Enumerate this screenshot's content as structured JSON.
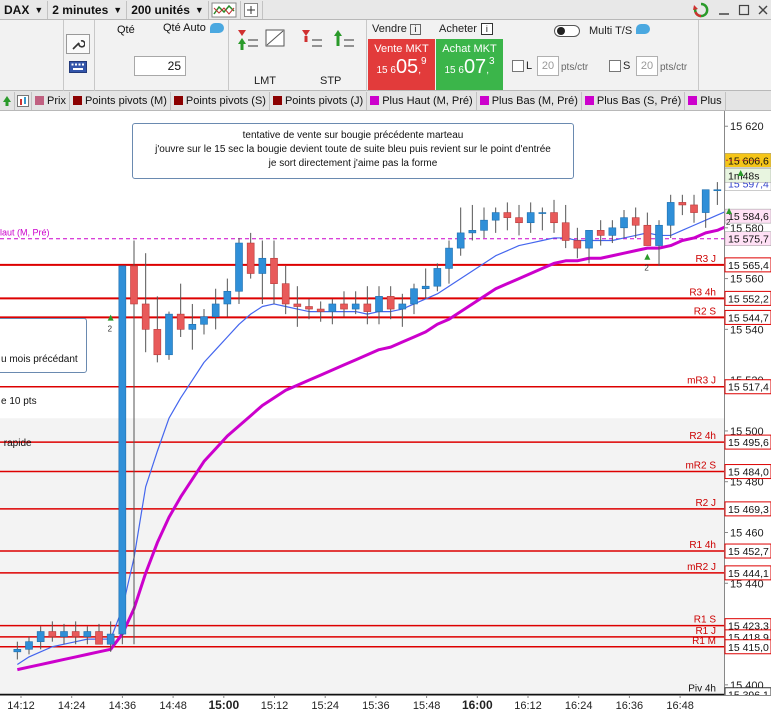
{
  "toolbar": {
    "instrument": "DAX",
    "interval": "2 minutes",
    "units": "200 unités"
  },
  "order_panel": {
    "qty_label": "Qté",
    "qty_auto_label": "Qté Auto",
    "qty_value": "25",
    "lmt_label": "LMT",
    "stp_label": "STP",
    "sell_label": "Vendre",
    "buy_label": "Acheter",
    "sell_mkt": {
      "label": "Vente MKT",
      "prefix": "15 6",
      "big": "05",
      "sup": "9"
    },
    "buy_mkt": {
      "label": "Achat MKT",
      "prefix": "15 6",
      "big": "07",
      "sup": "3"
    },
    "multi_ts_label": "Multi T/S",
    "l_label": "L",
    "s_label": "S",
    "pts_value": "20",
    "pts_unit": "pts/ctr",
    "colors": {
      "sell": "#e23b3b",
      "buy": "#3bb54a"
    }
  },
  "indicators": [
    {
      "label": "Prix",
      "color": "#c06080"
    },
    {
      "label": "Points pivots (M)",
      "color": "#8b0000"
    },
    {
      "label": "Points pivots (S)",
      "color": "#8b0000"
    },
    {
      "label": "Points pivots (J)",
      "color": "#8b0000"
    },
    {
      "label": "Plus Haut (M, Pré)",
      "color": "#cc00cc"
    },
    {
      "label": "Plus Bas (M, Pré)",
      "color": "#cc00cc"
    },
    {
      "label": "Plus Bas (S, Pré)",
      "color": "#cc00cc"
    },
    {
      "label": "Plus",
      "color": "#cc00cc"
    }
  ],
  "annotations": {
    "main_lines": [
      "tentative de vente sur bougie précédente marteau",
      "j'ouvre sur le 15 sec la bougie devient toute de suite bleu puis revient sur le point d'entrée",
      "je sort directement j'aime pas la forme"
    ],
    "left_lines": [
      "u mois précédant",
      "e 10 pts",
      " rapide"
    ]
  },
  "chart_data": {
    "type": "candlestick",
    "ylim": [
      15396,
      15626
    ],
    "y_ticks": [
      15400,
      15420,
      15440,
      15460,
      15480,
      15500,
      15520,
      15540,
      15560,
      15580,
      15600,
      15620
    ],
    "x_ticks": [
      "14:12",
      "14:24",
      "14:36",
      "14:48",
      "15:00",
      "15:12",
      "15:24",
      "15:36",
      "15:48",
      "16:00",
      "16:12",
      "16:24",
      "16:36",
      "16:48"
    ],
    "bold_x_ticks": [
      "15:00",
      "16:00"
    ],
    "current_price": "15 606,6",
    "timer": "1m48s",
    "levels": [
      {
        "label": "R3 J",
        "value": 15565.4,
        "price": "15 565,4",
        "color": "#dd0000",
        "width": 2
      },
      {
        "label": "R3 4h",
        "value": 15552.2,
        "price": "15 552,2",
        "color": "#dd0000",
        "width": 2
      },
      {
        "label": "R2 S",
        "value": 15544.7,
        "price": "15 544,7",
        "color": "#dd0000",
        "width": 2
      },
      {
        "label": "mR3 J",
        "value": 15517.4,
        "price": "15 517,4",
        "color": "#dd0000",
        "width": 1.5
      },
      {
        "label": "R2 4h",
        "value": 15495.6,
        "price": "15 495,6",
        "color": "#dd0000",
        "width": 1.5
      },
      {
        "label": "mR2 S",
        "value": 15484.0,
        "price": "15 484,0",
        "color": "#dd0000",
        "width": 1.5
      },
      {
        "label": "R2 J",
        "value": 15469.3,
        "price": "15 469,3",
        "color": "#dd0000",
        "width": 1.5
      },
      {
        "label": "R1 4h",
        "value": 15452.7,
        "price": "15 452,7",
        "color": "#dd0000",
        "width": 1.5
      },
      {
        "label": "mR2 J",
        "value": 15444.1,
        "price": "15 444,1",
        "color": "#dd0000",
        "width": 1.5
      },
      {
        "label": "R1 S",
        "value": 15423.3,
        "price": "15 423,3",
        "color": "#dd0000",
        "width": 1.5
      },
      {
        "label": "R1 J",
        "value": 15418.9,
        "price": "15 418,9",
        "color": "#dd0000",
        "width": 1.5
      },
      {
        "label": "R1 M",
        "value": 15415.0,
        "price": "15 415,0",
        "color": "#dd0000",
        "width": 1.5
      },
      {
        "label": "Piv 4h",
        "value": 15396.1,
        "price": "15 396,1",
        "color": "#111111",
        "width": 2
      }
    ],
    "price_tags": [
      {
        "value": 15606.6,
        "text": "15 606,6",
        "bg": "#f5c518"
      },
      {
        "value": 15597.4,
        "text": "15 597,4",
        "bg": "#ffffff",
        "fg": "#3344cc"
      },
      {
        "value": 15584.6,
        "text": "15 584,6",
        "bg": "#ffe0f5"
      },
      {
        "value": 15575.7,
        "text": "15 575,7",
        "bg": "#ffe0f5"
      }
    ],
    "dashed_high": {
      "value": 15575.7,
      "label": "laut (M, Pré)",
      "color": "#cc00cc"
    },
    "series": [
      {
        "name": "candles",
        "o": [
          15413,
          15414,
          15417,
          15421,
          15419,
          15421,
          15419,
          15421,
          15416,
          15420,
          15565,
          15550,
          15540,
          15530,
          15546,
          15540,
          15542,
          15545,
          15550,
          15555,
          15574,
          15562,
          15568,
          15558,
          15550,
          15549,
          15548,
          15547,
          15550,
          15548,
          15550,
          15547,
          15553,
          15548,
          15550,
          15556,
          15557,
          15564,
          15572,
          15578,
          15579,
          15583,
          15586,
          15584,
          15582,
          15586,
          15586,
          15582,
          15575,
          15572,
          15579,
          15577,
          15580,
          15584,
          15581,
          15573,
          15581,
          15590,
          15589,
          15586,
          15595,
          15595,
          15598,
          15603,
          15609
        ],
        "h": [
          15417,
          15419,
          15423,
          15425,
          15424,
          15425,
          15423,
          15424,
          15425,
          15427,
          15575,
          15570,
          15553,
          15547,
          15558,
          15550,
          15548,
          15556,
          15560,
          15576,
          15578,
          15575,
          15575,
          15565,
          15557,
          15552,
          15551,
          15552,
          15555,
          15555,
          15557,
          15557,
          15557,
          15554,
          15558,
          15564,
          15566,
          15575,
          15588,
          15589,
          15588,
          15588,
          15590,
          15589,
          15590,
          15588,
          15591,
          15589,
          15580,
          15577,
          15583,
          15583,
          15587,
          15588,
          15586,
          15583,
          15593,
          15593,
          15593,
          15592,
          15598,
          15602,
          15605,
          15610,
          15612
        ],
        "l": [
          15410,
          15412,
          15414,
          15417,
          15416,
          15416,
          15416,
          15416,
          15413,
          15416,
          15416,
          15531,
          15527,
          15528,
          15537,
          15532,
          15538,
          15540,
          15545,
          15550,
          15560,
          15550,
          15550,
          15546,
          15541,
          15544,
          15543,
          15542,
          15545,
          15546,
          15542,
          15542,
          15544,
          15541,
          15546,
          15552,
          15555,
          15558,
          15569,
          15575,
          15576,
          15578,
          15579,
          15577,
          15578,
          15579,
          15578,
          15572,
          15568,
          15566,
          15573,
          15574,
          15576,
          15576,
          15578,
          15565,
          15576,
          15585,
          15582,
          15580,
          15589,
          15592,
          15593,
          15600,
          15604
        ],
        "c": [
          15414,
          15417,
          15421,
          15419,
          15421,
          15419,
          15421,
          15416,
          15420,
          15565,
          15550,
          15540,
          15530,
          15546,
          15540,
          15542,
          15545,
          15550,
          15555,
          15574,
          15562,
          15568,
          15558,
          15550,
          15549,
          15548,
          15547,
          15550,
          15548,
          15550,
          15547,
          15553,
          15548,
          15550,
          15556,
          15557,
          15564,
          15572,
          15578,
          15579,
          15583,
          15586,
          15584,
          15582,
          15586,
          15586,
          15582,
          15575,
          15572,
          15579,
          15577,
          15580,
          15584,
          15581,
          15573,
          15581,
          15590,
          15589,
          15586,
          15595,
          15595,
          15598,
          15603,
          15609,
          15604
        ]
      },
      {
        "name": "ma_fast",
        "values": [
          15408,
          15411,
          15413,
          15415,
          15416,
          15417,
          15418,
          15418,
          15418,
          15430,
          15450,
          15478,
          15492,
          15505,
          15513,
          15520,
          15527,
          15532,
          15537,
          15542,
          15546,
          15549,
          15550,
          15549,
          15548,
          15547,
          15547,
          15547,
          15547,
          15547,
          15546,
          15547,
          15547,
          15548,
          15550,
          15552,
          15554,
          15557,
          15560,
          15563,
          15566,
          15569,
          15571,
          15573,
          15574,
          15575,
          15576,
          15576,
          15575,
          15575,
          15575,
          15575,
          15576,
          15577,
          15578,
          15577,
          15577,
          15579,
          15581,
          15583,
          15585,
          15587,
          15589,
          15592,
          15595
        ]
      },
      {
        "name": "ma_slow",
        "values": [
          15406,
          15407,
          15408,
          15409,
          15410,
          15411,
          15412,
          15413,
          15414,
          15420,
          15430,
          15444,
          15456,
          15466,
          15474,
          15481,
          15488,
          15493,
          15498,
          15502,
          15506,
          15510,
          15513,
          15516,
          15518,
          15520,
          15522,
          15524,
          15526,
          15528,
          15530,
          15532,
          15533,
          15535,
          15537,
          15539,
          15542,
          15544,
          15547,
          15550,
          15553,
          15556,
          15558,
          15560,
          15562,
          15564,
          15566,
          15567,
          15567,
          15568,
          15568,
          15569,
          15570,
          15571,
          15572,
          15572,
          15573,
          15575,
          15576,
          15578,
          15579,
          15581,
          15583,
          15585,
          15587
        ]
      }
    ]
  }
}
